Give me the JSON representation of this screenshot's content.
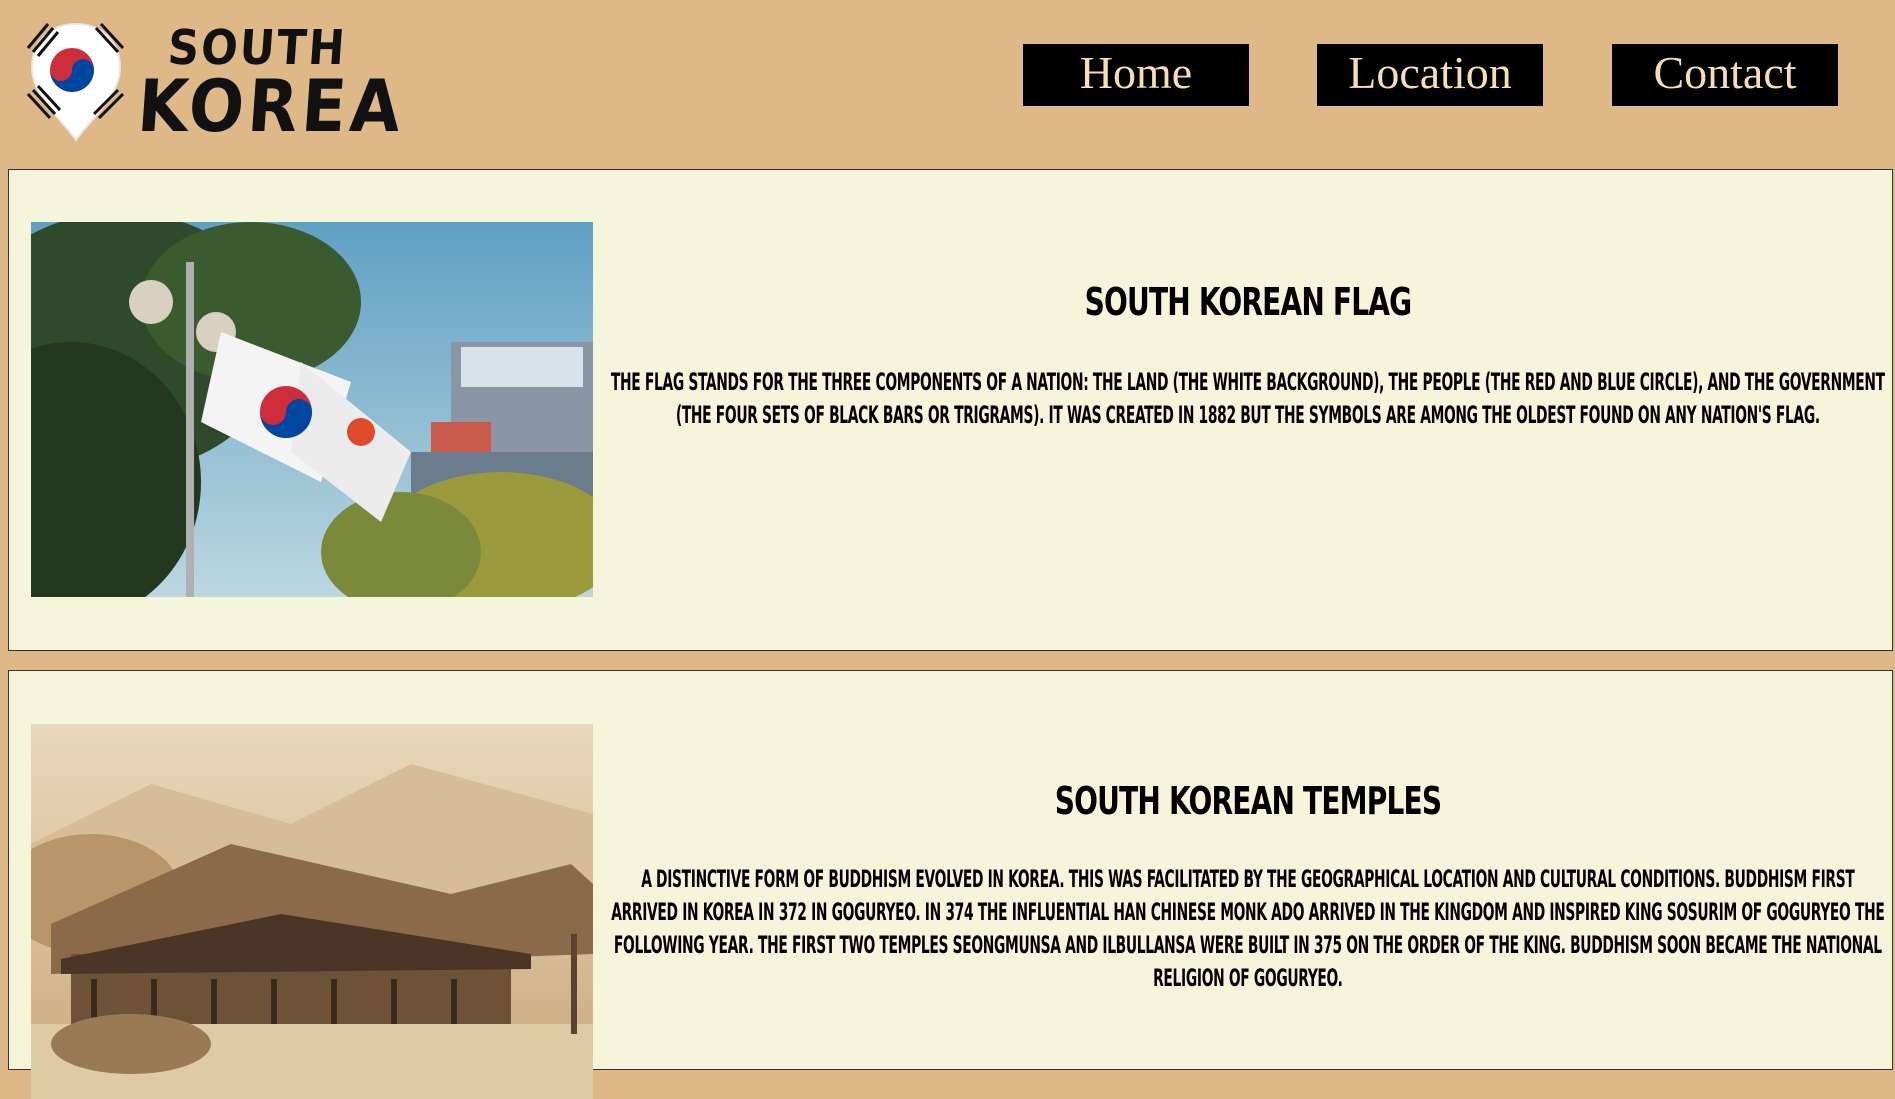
{
  "header": {
    "logo": {
      "line1": "SOUTH",
      "line2": "KOREA",
      "icon": "korean-flag-pin-icon"
    },
    "nav": [
      {
        "label": "Home"
      },
      {
        "label": "Location"
      },
      {
        "label": "Contact"
      }
    ]
  },
  "sections": [
    {
      "image": "korean-flags-photo",
      "title": "SOUTH KOREAN FLAG",
      "text": "THE FLAG STANDS FOR THE THREE COMPONENTS OF A NATION: THE LAND (THE WHITE BACKGROUND), THE PEOPLE (THE RED AND BLUE CIRCLE), AND THE GOVERNMENT (THE FOUR SETS OF BLACK BARS OR TRIGRAMS). IT WAS CREATED IN 1882 BUT THE SYMBOLS ARE AMONG THE OLDEST FOUND ON ANY NATION'S FLAG."
    },
    {
      "image": "temple-sepia-photo",
      "title": "SOUTH KOREAN TEMPLES",
      "text": "A DISTINCTIVE FORM OF BUDDHISM EVOLVED IN KOREA. THIS WAS FACILITATED BY THE GEOGRAPHICAL LOCATION AND CULTURAL CONDITIONS. BUDDHISM FIRST ARRIVED IN KOREA IN 372 IN GOGURYEO. IN 374 THE INFLUENTIAL HAN CHINESE MONK ADO ARRIVED IN THE KINGDOM AND INSPIRED KING SOSURIM OF GOGURYEO THE FOLLOWING YEAR. THE FIRST TWO TEMPLES SEONGMUNSA AND ILBULLANSA WERE BUILT IN 375 ON THE ORDER OF THE KING. BUDDHISM SOON BECAME THE NATIONAL RELIGION OF GOGURYEO."
    }
  ],
  "colors": {
    "background": "#DEB887",
    "card": "#F5F5DC",
    "nav_bg": "#000000",
    "nav_text": "#F5DEB3"
  }
}
